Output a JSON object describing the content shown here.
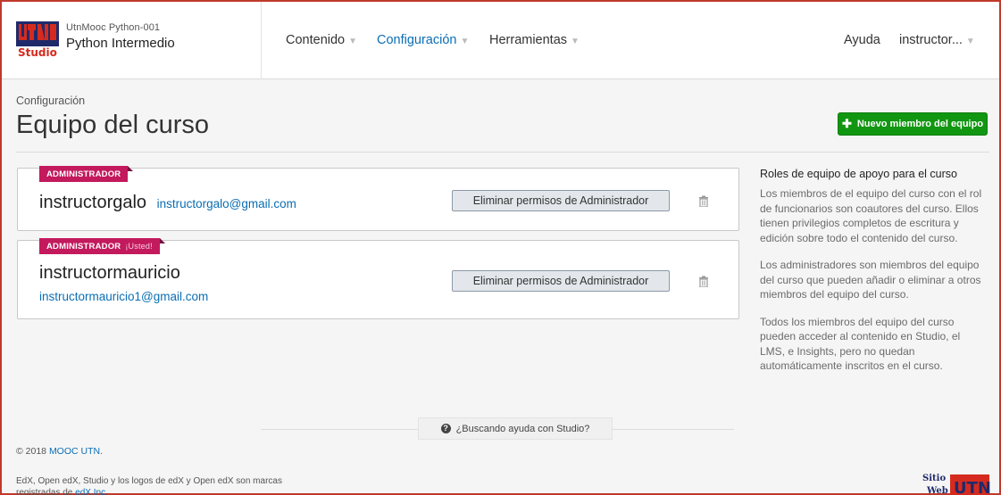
{
  "header": {
    "logo_text": "UTN",
    "logo_sub": "Studio",
    "course_org": "UtnMooc Python-001",
    "course_name": "Python Intermedio",
    "nav": [
      {
        "label": "Contenido"
      },
      {
        "label": "Configuración"
      },
      {
        "label": "Herramientas"
      }
    ],
    "help_label": "Ayuda",
    "user_label": "instructor..."
  },
  "page": {
    "breadcrumb": "Configuración",
    "title": "Equipo del curso",
    "new_member_label": "Nuevo miembro del equipo"
  },
  "members": [
    {
      "role": "ADMINISTRADOR",
      "you": "",
      "name": "instructorgalo",
      "email": "instructorgalo@gmail.com",
      "remove_label": "Eliminar permisos de Administrador"
    },
    {
      "role": "ADMINISTRADOR",
      "you": "¡Usted!",
      "name": "instructormauricio",
      "email": "instructormauricio1@gmail.com",
      "remove_label": "Eliminar permisos de Administrador"
    }
  ],
  "sidebar": {
    "title": "Roles de equipo de apoyo para el curso",
    "paragraphs": [
      "Los miembros de el equipo del curso con el rol de funcionarios son coautores del curso. Ellos tienen privilegios completos de escritura y edición sobre todo el contenido del curso.",
      "Los administradores son miembros del equipo del curso que pueden añadir o eliminar a otros miembros del equipo del curso.",
      "Todos los miembros del equipo del curso pueden acceder al contenido en Studio, el LMS, e Insights, pero no quedan automáticamente inscritos en el curso."
    ]
  },
  "help": {
    "label": "¿Buscando ayuda con Studio?"
  },
  "footer": {
    "copyright_prefix": "© 2018 ",
    "copyright_link": "MOOC UTN",
    "copyright_suffix": ".",
    "legal_text": "EdX, Open edX, Studio y los logos de edX y Open edX son marcas registradas de ",
    "legal_link": "edX Inc",
    "legal_suffix": ".",
    "logo_line1": "Sitio",
    "logo_line2": "Web",
    "logo_text": "UTN"
  },
  "colors": {
    "accent_blue": "#0a6eb4",
    "role_badge": "#c3195d",
    "primary_green": "#119611",
    "logo_red": "#d52b1e",
    "logo_navy": "#1f2a6b"
  },
  "icons": {
    "caret": "caret-down-icon",
    "trash": "trash-icon",
    "plus": "plus-icon",
    "help": "question-circle-icon"
  }
}
